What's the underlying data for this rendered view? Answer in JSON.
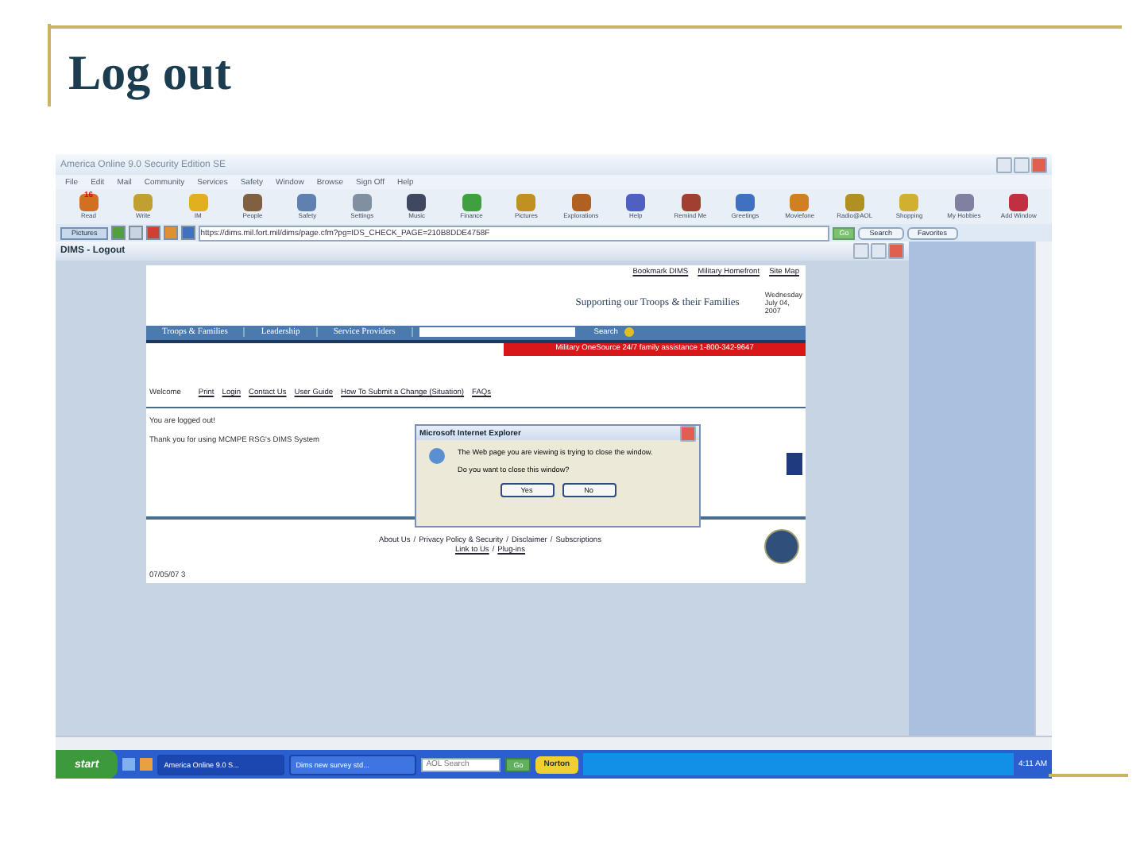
{
  "slide": {
    "title": "Log out"
  },
  "window": {
    "title": "America Online 9.0 Security Edition SE"
  },
  "menu": [
    "File",
    "Edit",
    "Mail",
    "Community",
    "Services",
    "Safety",
    "Window",
    "Browse",
    "Sign Off",
    "Help"
  ],
  "toolbar": [
    {
      "label": "Read",
      "badge": "16"
    },
    {
      "label": "Write"
    },
    {
      "label": "IM"
    },
    {
      "label": "People"
    },
    {
      "label": "Safety"
    },
    {
      "label": "Settings"
    },
    {
      "label": "Music"
    },
    {
      "label": "Finance"
    },
    {
      "label": "Pictures"
    },
    {
      "label": "Explorations"
    },
    {
      "label": "Help"
    },
    {
      "label": "Remind Me"
    },
    {
      "label": "Greetings"
    },
    {
      "label": "Moviefone"
    },
    {
      "label": "Radio@AOL"
    },
    {
      "label": "Shopping"
    },
    {
      "label": "My Hobbies"
    },
    {
      "label": "Add Window"
    }
  ],
  "address_bar": {
    "button": "Pictures",
    "url": "https://dims.mil.fort.mil/dims/page.cfm?pg=IDS_CHECK_PAGE=210B8DDE4758F",
    "go": "Go",
    "search": "Search",
    "favorites": "Favorites"
  },
  "inner_window": {
    "title": "DIMS - Logout"
  },
  "page": {
    "top_links": [
      "Bookmark DIMS",
      "Military Homefront",
      "Site Map"
    ],
    "tagline": "Supporting our Troops & their Families",
    "date": [
      "Wednesday",
      "July 04,",
      "2007"
    ],
    "nav": [
      "Troops & Families",
      "Leadership",
      "Service Providers"
    ],
    "search_button": "Search",
    "banner": "Military OneSource 24/7 family assistance 1-800-342-9647",
    "welcome": "Welcome",
    "links": [
      "Print",
      "Login",
      "Contact Us",
      "User Guide",
      "How To Submit a Change (Situation)",
      "FAQs"
    ],
    "messages": [
      "You are logged out!",
      "Thank you for using MCMPE RSG's DIMS System"
    ],
    "footer_links": [
      "About Us",
      "Privacy Policy & Security",
      "Disclaimer",
      "Subscriptions"
    ],
    "footer_links_2": [
      "Link to Us",
      "Plug-ins"
    ],
    "separator": "/",
    "stamp": "07/05/07 3"
  },
  "dialog": {
    "title": "Microsoft Internet Explorer",
    "message": "The Web page you are viewing is trying to close the window.",
    "question": "Do you want to close this window?",
    "buttons": [
      "Yes",
      "No"
    ]
  },
  "taskbar": {
    "start": "start",
    "tasks": [
      {
        "label": "America Online 9.0 S...",
        "selected": true
      },
      {
        "label": "Dims new survey std...",
        "selected": false
      }
    ],
    "search_placeholder": "AOL Search",
    "go": "Go",
    "norton": "Norton",
    "clock": "4:11 AM"
  }
}
